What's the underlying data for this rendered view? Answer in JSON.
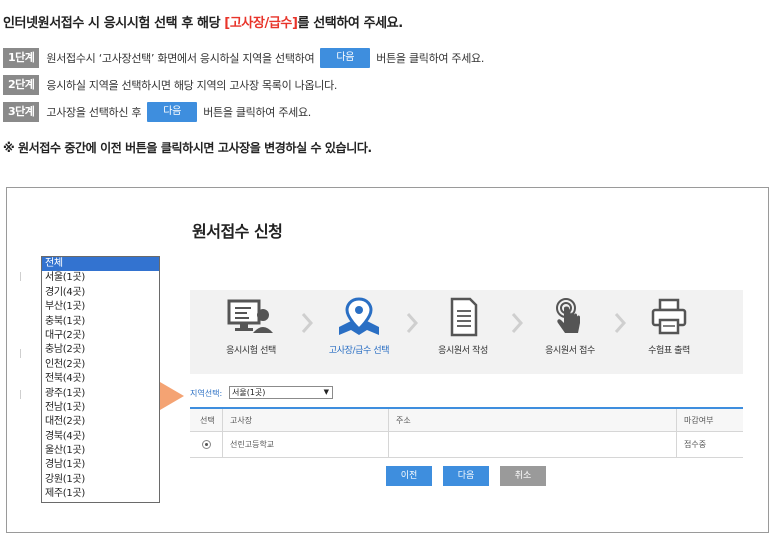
{
  "instructions": {
    "headline_pre": "인터넷원서접수 시 응시시험 선택 후 해당 ",
    "headline_highlight": "[고사장/급수]",
    "headline_post": "를 선택하여 주세요.",
    "steps": [
      {
        "badge": "1단계",
        "pre": "원서접수시 ‘고사장선택’ 화면에서 응시하실 지역을 선택하여",
        "button": "다음",
        "post": "버튼을 클릭하여 주세요."
      },
      {
        "badge": "2단계",
        "pre": "응시하실 지역을 선택하시면 해당 지역의 고사장 목록이 나옵니다.",
        "button": "",
        "post": ""
      },
      {
        "badge": "3단계",
        "pre": "고사장을 선택하신 후",
        "button": "다음",
        "post": "버튼을 클릭하여 주세요."
      }
    ],
    "note": "※ 원서접수 중간에 이전 버튼을 클릭하시면 고사장을 변경하실 수 있습니다."
  },
  "app": {
    "title": "원서접수 신청",
    "process_steps": [
      {
        "label": "응시시험 선택",
        "icon": "computer-user-icon"
      },
      {
        "label": "고사장/급수 선택",
        "icon": "map-pin-icon",
        "active": true
      },
      {
        "label": "응시원서 작성",
        "icon": "document-icon"
      },
      {
        "label": "응시원서 접수",
        "icon": "touch-hand-icon"
      },
      {
        "label": "수험표 출력",
        "icon": "printer-icon"
      }
    ],
    "region": {
      "label": "지역선택:",
      "selected": "서울(1곳)"
    },
    "table": {
      "headers": [
        "선택",
        "고사장",
        "주소",
        "마감여부"
      ],
      "rows": [
        {
          "name": "선린고등학교",
          "address": "",
          "status": "접수중"
        }
      ]
    },
    "buttons": {
      "prev": "이전",
      "next": "다음",
      "cancel": "취소"
    },
    "dropdown_options": [
      "전체",
      "서울(1곳)",
      "경기(4곳)",
      "부산(1곳)",
      "충북(1곳)",
      "대구(2곳)",
      "충남(2곳)",
      "인천(2곳)",
      "전북(4곳)",
      "광주(1곳)",
      "전남(1곳)",
      "대전(2곳)",
      "경북(4곳)",
      "울산(1곳)",
      "경남(1곳)",
      "강원(1곳)",
      "제주(1곳)"
    ],
    "dropdown_highlighted": "전체"
  },
  "colors": {
    "accent": "#3e8ede",
    "highlight_text": "#e8342a",
    "arrow": "#f4a373",
    "badge": "#8a8a8a"
  }
}
